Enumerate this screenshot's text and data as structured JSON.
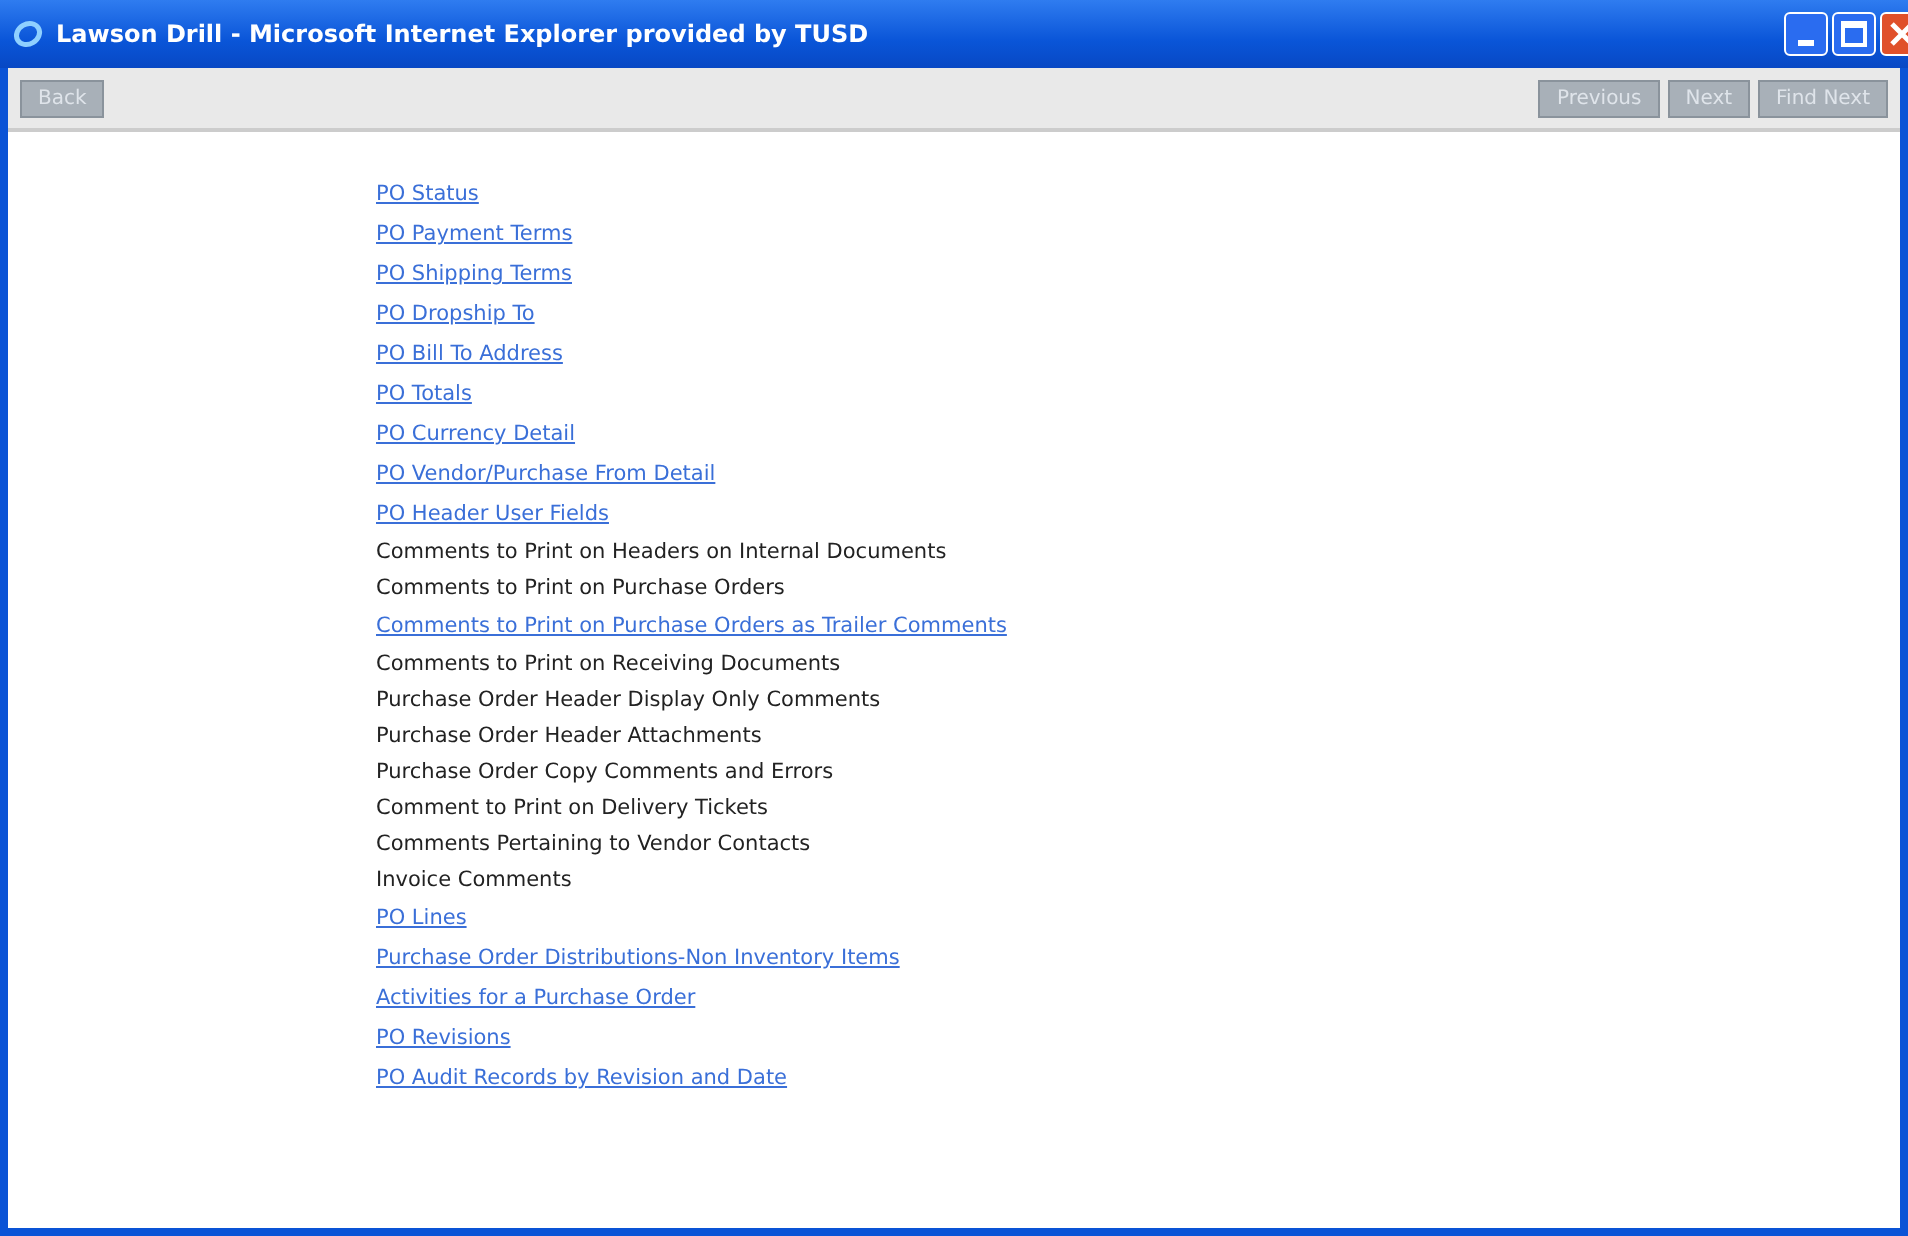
{
  "window": {
    "title": "Lawson Drill - Microsoft Internet Explorer provided by TUSD"
  },
  "toolbar": {
    "left_buttons": [
      {
        "label": "Back",
        "disabled": true
      }
    ],
    "right_buttons": [
      {
        "label": "Previous",
        "disabled": true
      },
      {
        "label": "Next",
        "disabled": true
      },
      {
        "label": "Find Next",
        "disabled": true
      }
    ]
  },
  "items": [
    {
      "kind": "link",
      "text": "PO Status"
    },
    {
      "kind": "link",
      "text": "PO Payment Terms"
    },
    {
      "kind": "link",
      "text": "PO Shipping Terms"
    },
    {
      "kind": "link",
      "text": "PO Dropship To"
    },
    {
      "kind": "link",
      "text": "PO Bill To Address"
    },
    {
      "kind": "link",
      "text": "PO Totals"
    },
    {
      "kind": "link",
      "text": "PO Currency Detail"
    },
    {
      "kind": "link",
      "text": "PO Vendor/Purchase From Detail"
    },
    {
      "kind": "link",
      "text": "PO Header User Fields"
    },
    {
      "kind": "text",
      "text": "Comments to Print on Headers on Internal Documents"
    },
    {
      "kind": "text",
      "text": "Comments to Print on Purchase Orders"
    },
    {
      "kind": "link",
      "text": "Comments to Print on Purchase Orders as Trailer Comments"
    },
    {
      "kind": "text",
      "text": "Comments to Print on Receiving Documents"
    },
    {
      "kind": "text",
      "text": "Purchase Order Header Display Only Comments"
    },
    {
      "kind": "text",
      "text": "Purchase Order Header Attachments"
    },
    {
      "kind": "text",
      "text": "Purchase Order Copy Comments and Errors"
    },
    {
      "kind": "text",
      "text": "Comment to Print on Delivery Tickets"
    },
    {
      "kind": "text",
      "text": "Comments Pertaining to Vendor Contacts"
    },
    {
      "kind": "text",
      "text": "Invoice Comments"
    },
    {
      "kind": "link",
      "text": "PO Lines"
    },
    {
      "kind": "link",
      "text": "Purchase Order Distributions-Non Inventory Items"
    },
    {
      "kind": "link",
      "text": "Activities for a Purchase Order"
    },
    {
      "kind": "link",
      "text": "PO Revisions"
    },
    {
      "kind": "link",
      "text": "PO Audit Records by Revision and Date"
    }
  ]
}
